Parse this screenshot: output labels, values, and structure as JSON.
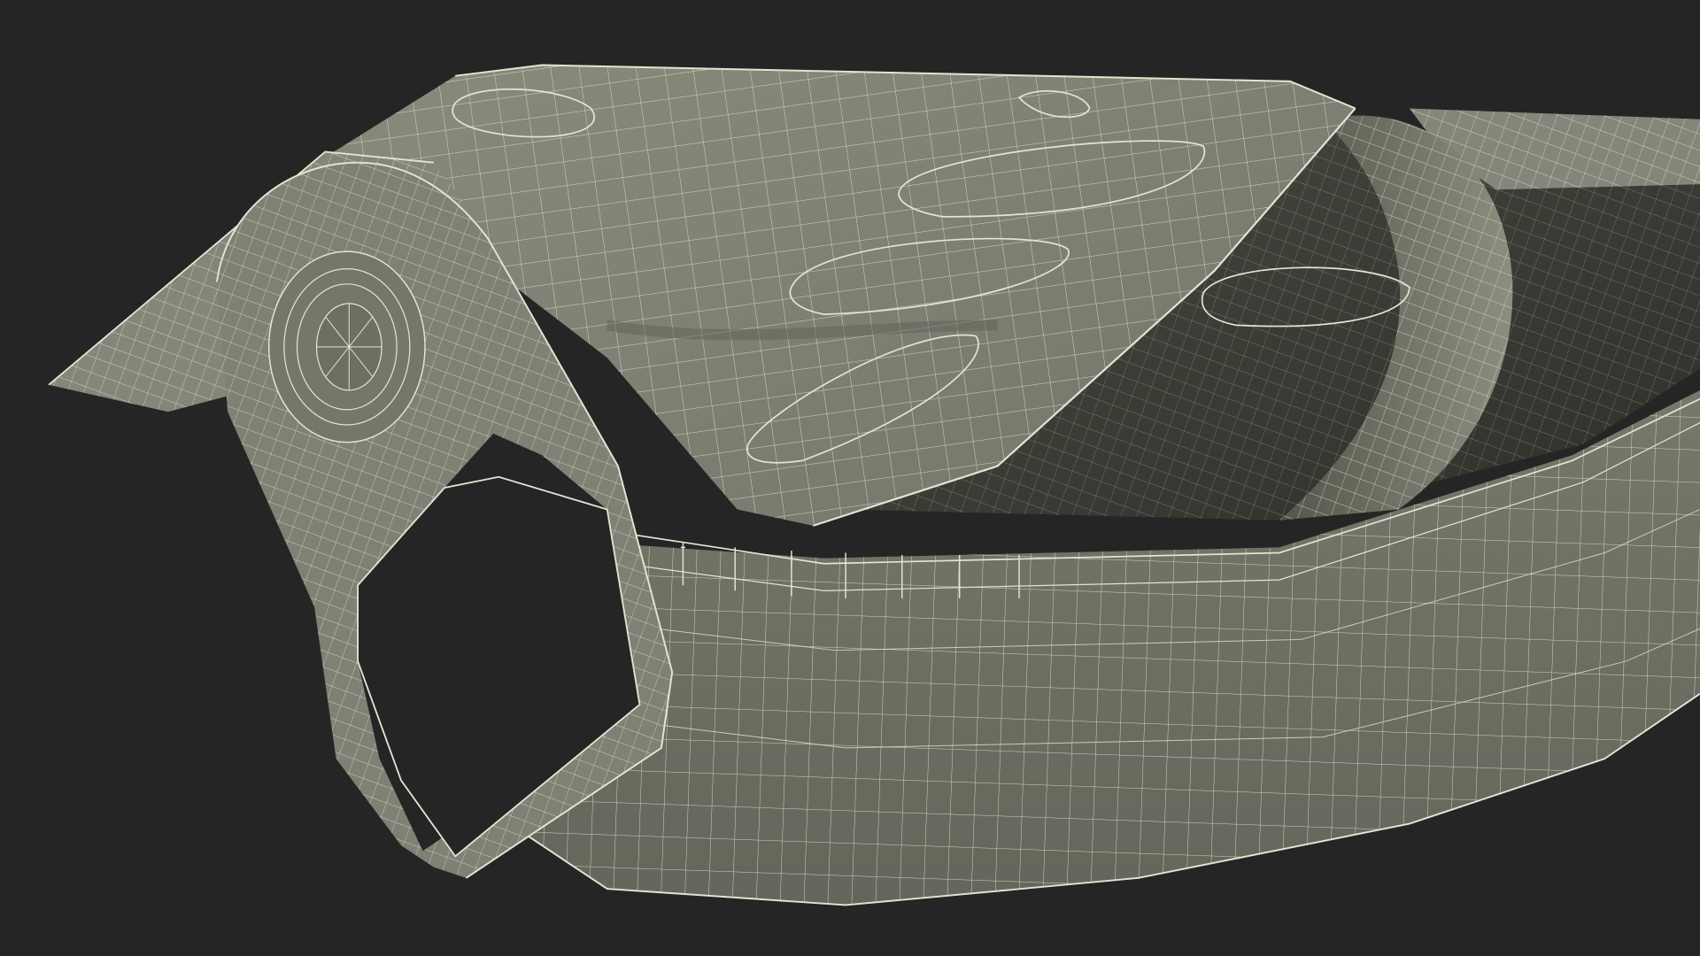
{
  "scene": {
    "subject": "open-sardine-tin-wireframe",
    "colors": {
      "background": "#252525",
      "surface": "#7b7b6e",
      "surface_dark": "#55564b",
      "interior": "#3a3b33",
      "wire": "#e4e4d2"
    }
  }
}
